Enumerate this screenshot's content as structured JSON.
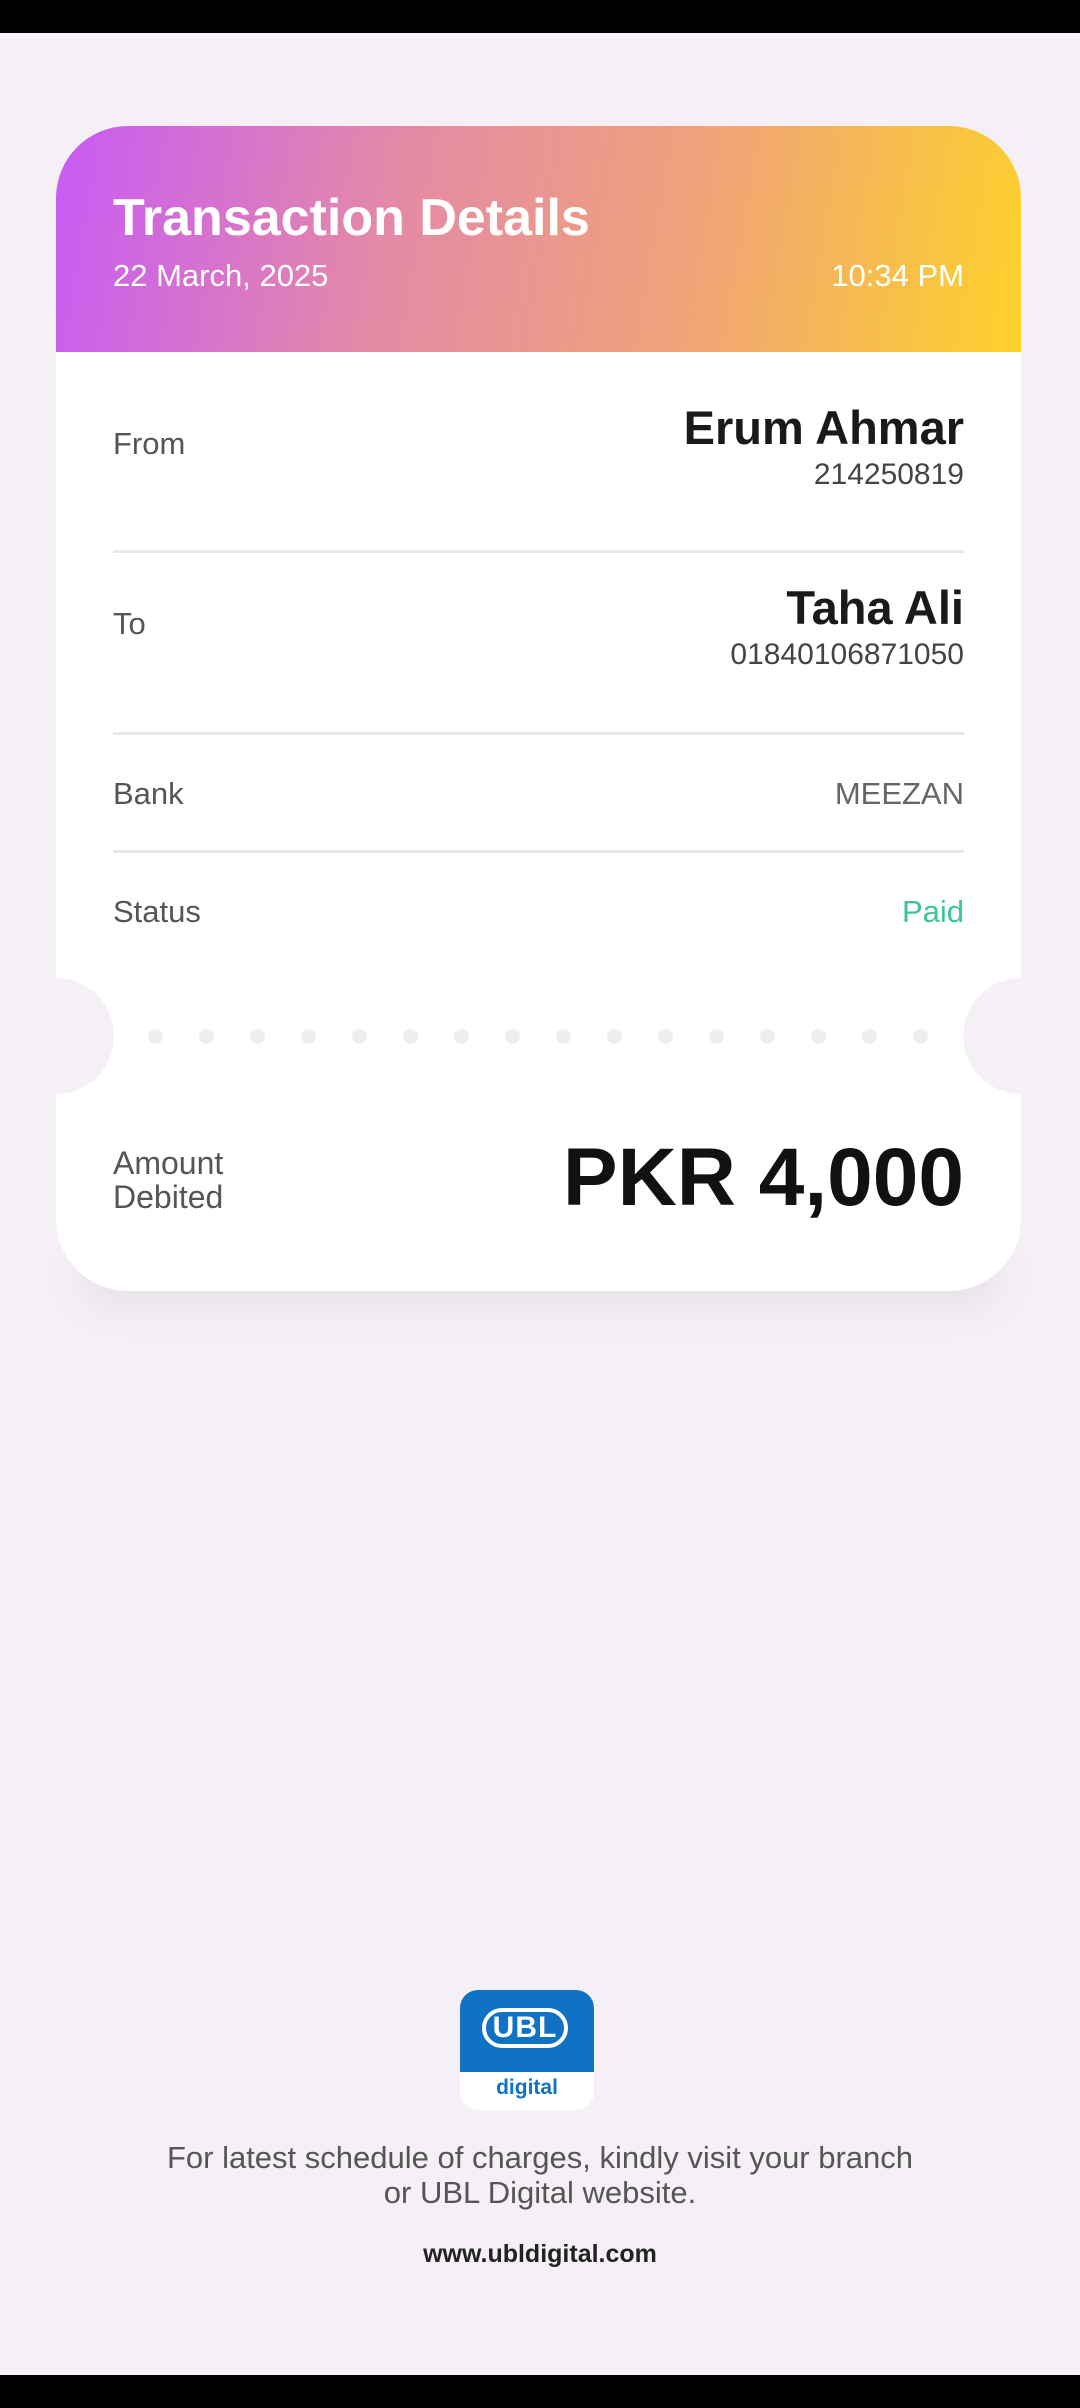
{
  "header": {
    "title": "Transaction Details",
    "date": "22 March, 2025",
    "time": "10:34 PM"
  },
  "from": {
    "label": "From",
    "name": "Erum Ahmar",
    "account": "214250819"
  },
  "to": {
    "label": "To",
    "name": "Taha Ali",
    "account": "01840106871050"
  },
  "bank": {
    "label": "Bank",
    "value": "MEEZAN"
  },
  "status": {
    "label": "Status",
    "value": "Paid"
  },
  "amount": {
    "label_line1": "Amount",
    "label_line2": "Debited",
    "value": "PKR 4,000"
  },
  "footer": {
    "logo_text": "UBL",
    "logo_subtext": "digital",
    "note_line1": "For latest schedule of charges, kindly visit your branch",
    "note_line2": "or UBL Digital website.",
    "url": "www.ubldigital.com"
  },
  "colors": {
    "gradient_start": "#c85af6",
    "gradient_end": "#fdd22a",
    "status_paid": "#3cc49a",
    "brand_blue": "#0f72c4",
    "background": "#f5f0f5"
  }
}
